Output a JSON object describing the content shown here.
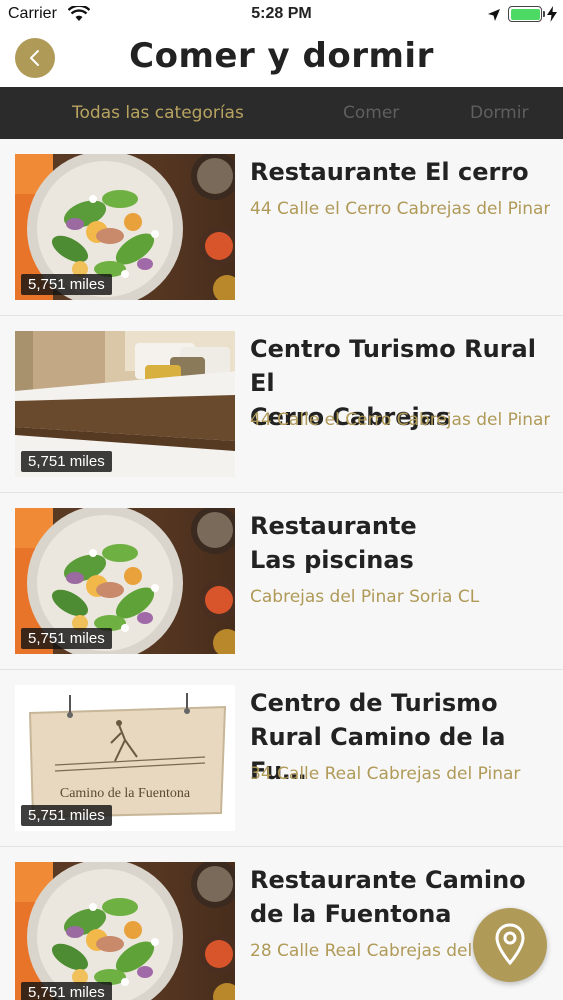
{
  "status_bar": {
    "carrier": "Carrier",
    "time": "5:28 PM"
  },
  "header": {
    "title": "Comer y dormir",
    "back_icon": "chevron-left-icon"
  },
  "tabs": [
    {
      "label": "Todas las categorías",
      "active": true
    },
    {
      "label": "Comer",
      "active": false
    },
    {
      "label": "Dormir",
      "active": false
    }
  ],
  "items": [
    {
      "name": "Restaurante El cerro",
      "address": "44 Calle el Cerro Cabrejas del Pinar",
      "distance": "5,751 miles",
      "image": "salad-photo"
    },
    {
      "name": "Centro Turismo Rural El\nCerro Cabrejas",
      "address": "44 Calle el Cerro Cabrejas del Pinar",
      "distance": "5,751 miles",
      "image": "bed-photo"
    },
    {
      "name": "Restaurante\nLas piscinas",
      "address": "Cabrejas del Pinar Soria CL",
      "distance": "5,751 miles",
      "image": "salad-photo"
    },
    {
      "name": "Centro de Turismo\nRural Camino de la Fu…",
      "address": "34 Calle Real Cabrejas del Pinar",
      "distance": "5,751 miles",
      "image": "wooden-sign-logo",
      "logo_text": "Camino de la Fuentona"
    },
    {
      "name": "Restaurante Camino\nde la Fuentona",
      "address": "28 Calle Real Cabrejas del Pinar",
      "distance": "5,751 miles",
      "image": "salad-photo"
    }
  ],
  "map_button": {
    "icon": "map-pin-icon"
  },
  "colors": {
    "accent": "#b09a58",
    "tab_bar": "#2b2b2b",
    "tab_active": "#b8a460",
    "tab_inactive": "#5f5f5f"
  }
}
